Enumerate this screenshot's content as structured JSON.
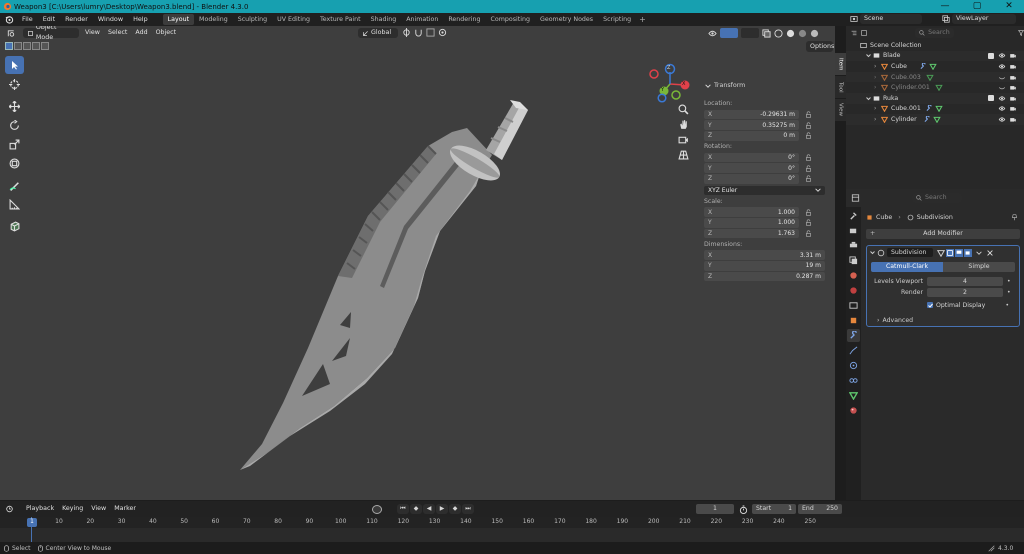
{
  "window": {
    "title": "Weapon3 [C:\\Users\\lumry\\Desktop\\Weapon3.blend] - Blender 4.3.0",
    "minimize": "—",
    "maximize": "▢",
    "close": "✕"
  },
  "menus": [
    "File",
    "Edit",
    "Render",
    "Window",
    "Help"
  ],
  "workspaces": [
    "Layout",
    "Modeling",
    "Sculpting",
    "UV Editing",
    "Texture Paint",
    "Shading",
    "Animation",
    "Rendering",
    "Compositing",
    "Geometry Nodes",
    "Scripting"
  ],
  "active_workspace": "Layout",
  "scene": {
    "label": "Scene",
    "view_layer": "ViewLayer"
  },
  "viewport": {
    "mode": "Object Mode",
    "menus": [
      "View",
      "Select",
      "Add",
      "Object"
    ],
    "orientation": "Global",
    "options": "Options"
  },
  "gizmo": {
    "x": "X",
    "y": "Y",
    "z": "Z"
  },
  "npanel": {
    "tabs": [
      "Item",
      "Tool",
      "View"
    ],
    "header": "Transform",
    "location_label": "Location:",
    "location": [
      {
        "axis": "X",
        "value": "-0.29631 m"
      },
      {
        "axis": "Y",
        "value": "0.35275 m"
      },
      {
        "axis": "Z",
        "value": "0 m"
      }
    ],
    "rotation_label": "Rotation:",
    "rotation": [
      {
        "axis": "X",
        "value": "0°"
      },
      {
        "axis": "Y",
        "value": "0°"
      },
      {
        "axis": "Z",
        "value": "0°"
      }
    ],
    "rotation_mode": "XYZ Euler",
    "scale_label": "Scale:",
    "scale": [
      {
        "axis": "X",
        "value": "1.000"
      },
      {
        "axis": "Y",
        "value": "1.000"
      },
      {
        "axis": "Z",
        "value": "1.763"
      }
    ],
    "dimensions_label": "Dimensions:",
    "dimensions": [
      {
        "axis": "X",
        "value": "3.31 m"
      },
      {
        "axis": "Y",
        "value": "19 m"
      },
      {
        "axis": "Z",
        "value": "0.287 m"
      }
    ]
  },
  "outliner": {
    "search_placeholder": "Search",
    "root": "Scene Collection",
    "items": [
      {
        "name": "Blade",
        "type": "collection"
      },
      {
        "name": "Cube",
        "type": "mesh"
      },
      {
        "name": "Cube.003",
        "type": "mesh"
      },
      {
        "name": "Cylinder.001",
        "type": "mesh"
      },
      {
        "name": "Ruka",
        "type": "collection"
      },
      {
        "name": "Cube.001",
        "type": "mesh"
      },
      {
        "name": "Cylinder",
        "type": "mesh"
      }
    ]
  },
  "properties": {
    "search_placeholder": "Search",
    "object": "Cube",
    "modifier_tab": "Subdivision",
    "add_modifier": "Add Modifier",
    "modifier": {
      "name": "Subdivision",
      "type_options": [
        "Catmull-Clark",
        "Simple"
      ],
      "active_type": "Catmull-Clark",
      "levels_viewport_label": "Levels Viewport",
      "levels_viewport": "4",
      "render_label": "Render",
      "render": "2",
      "optimal_display": "Optimal Display",
      "advanced": "Advanced"
    }
  },
  "timeline": {
    "menus": [
      "Playback",
      "Keying",
      "View",
      "Marker"
    ],
    "current_frame": "1",
    "start_label": "Start",
    "start": "1",
    "end_label": "End",
    "end": "250",
    "ruler": [
      "1",
      "10",
      "20",
      "30",
      "40",
      "50",
      "60",
      "70",
      "80",
      "90",
      "100",
      "110",
      "120",
      "130",
      "140",
      "150",
      "160",
      "170",
      "180",
      "190",
      "200",
      "210",
      "220",
      "230",
      "240",
      "250"
    ]
  },
  "status": {
    "select": "Select",
    "center_view": "Center View to Mouse",
    "version": "4.3.0"
  },
  "colors": {
    "accent": "#4772b3",
    "titlebar": "#17a0b0",
    "viewport_bg": "#3e3e3e",
    "object_orange": "#e6873c",
    "mesh_green": "#5fc86e"
  }
}
